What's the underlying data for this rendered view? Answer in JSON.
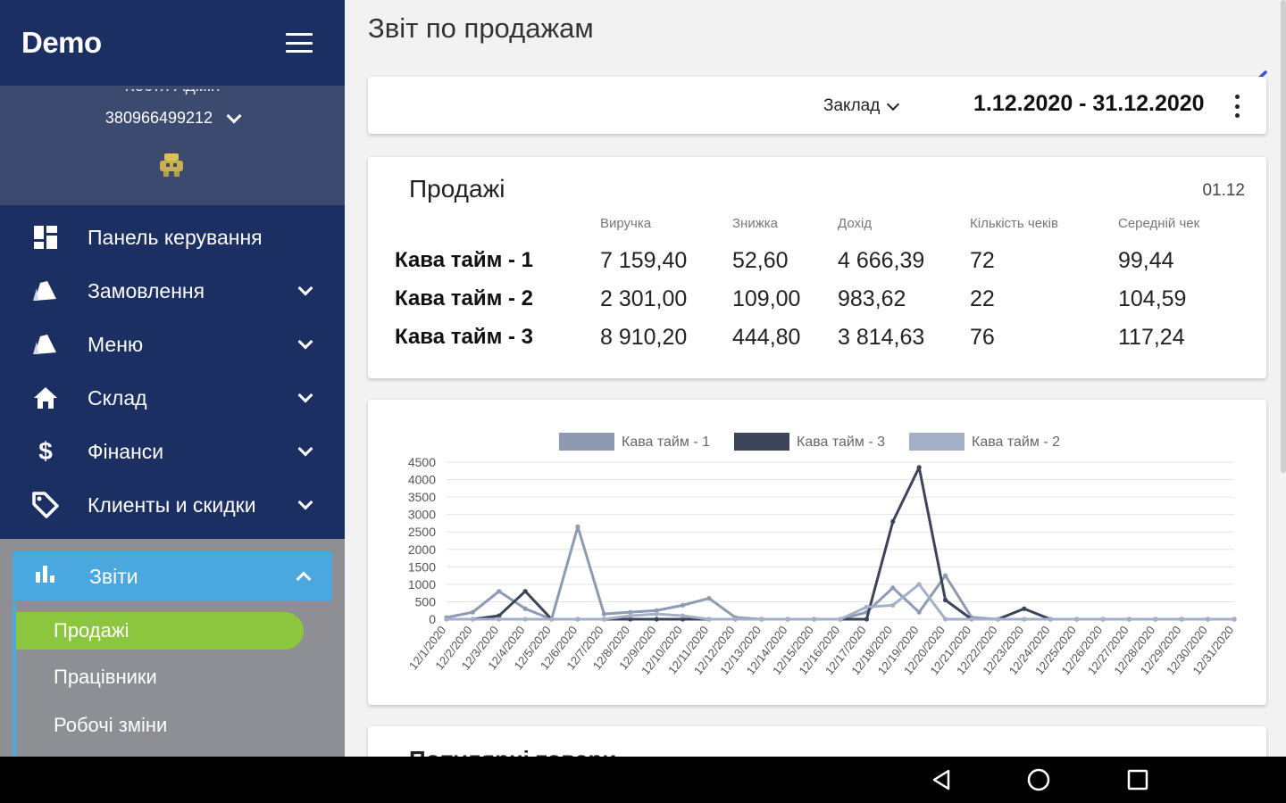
{
  "app": {
    "brand": "Demo"
  },
  "profile": {
    "name": "Костя Адмін",
    "phone": "380966499212"
  },
  "sidebar": {
    "items": [
      {
        "label": "Панель керування",
        "icon": "dashboard-icon",
        "expandable": false
      },
      {
        "label": "Замовлення",
        "icon": "orders-icon",
        "expandable": true
      },
      {
        "label": "Меню",
        "icon": "menu-book-icon",
        "expandable": true
      },
      {
        "label": "Склад",
        "icon": "home-icon",
        "expandable": true
      },
      {
        "label": "Фінанси",
        "icon": "dollar-icon",
        "expandable": true
      },
      {
        "label": "Клиенты и скидки",
        "icon": "tag-icon",
        "expandable": true
      }
    ],
    "reports": {
      "label": "Звіти",
      "icon": "bar-chart-icon",
      "subitems": [
        {
          "label": "Продажі",
          "active": true
        },
        {
          "label": "Працівники",
          "active": false
        },
        {
          "label": "Робочі зміни",
          "active": false
        }
      ]
    }
  },
  "page": {
    "title": "Звіт по продажам",
    "filter": {
      "venue_label": "Заклад",
      "date_range": "1.12.2020 - 31.12.2020"
    }
  },
  "sales": {
    "title": "Продажі",
    "date": "01.12",
    "columns": [
      "Виручка",
      "Знижка",
      "Дохід",
      "Кількість чеків",
      "Середній чек"
    ],
    "rows": [
      {
        "name": "Кава тайм - 1",
        "values": [
          "7 159,40",
          "52,60",
          "4 666,39",
          "72",
          "99,44"
        ]
      },
      {
        "name": "Кава тайм - 2",
        "values": [
          "2 301,00",
          "109,00",
          "983,62",
          "22",
          "104,59"
        ]
      },
      {
        "name": "Кава тайм - 3",
        "values": [
          "8 910,20",
          "444,80",
          "3 814,63",
          "76",
          "117,24"
        ]
      }
    ]
  },
  "chart_data": {
    "type": "line",
    "title": "",
    "xlabel": "",
    "ylabel": "",
    "ylim": [
      0,
      4500
    ],
    "yticks": [
      0,
      500,
      1000,
      1500,
      2000,
      2500,
      3000,
      3500,
      4000,
      4500
    ],
    "grid": true,
    "legend_position": "top-center",
    "categories": [
      "12/1/2020",
      "12/2/2020",
      "12/3/2020",
      "12/4/2020",
      "12/5/2020",
      "12/6/2020",
      "12/7/2020",
      "12/8/2020",
      "12/9/2020",
      "12/10/2020",
      "12/11/2020",
      "12/12/2020",
      "12/13/2020",
      "12/14/2020",
      "12/15/2020",
      "12/16/2020",
      "12/17/2020",
      "12/18/2020",
      "12/19/2020",
      "12/20/2020",
      "12/21/2020",
      "12/22/2020",
      "12/23/2020",
      "12/24/2020",
      "12/25/2020",
      "12/26/2020",
      "12/27/2020",
      "12/28/2020",
      "12/29/2020",
      "12/30/2020",
      "12/31/2020"
    ],
    "series": [
      {
        "name": "Кава тайм - 1",
        "color": "#8e9ab2",
        "values": [
          50,
          200,
          800,
          300,
          0,
          2650,
          150,
          200,
          250,
          400,
          600,
          50,
          0,
          0,
          0,
          0,
          200,
          900,
          200,
          1250,
          50,
          0,
          0,
          0,
          0,
          0,
          0,
          0,
          0,
          0,
          0
        ]
      },
      {
        "name": "Кава тайм - 3",
        "color": "#3b4458",
        "values": [
          0,
          0,
          100,
          800,
          0,
          0,
          0,
          0,
          0,
          0,
          0,
          0,
          0,
          0,
          0,
          0,
          0,
          2800,
          4350,
          550,
          0,
          0,
          300,
          0,
          0,
          0,
          0,
          0,
          0,
          0,
          0
        ]
      },
      {
        "name": "Кава тайм - 2",
        "color": "#a4afc8",
        "values": [
          0,
          0,
          0,
          0,
          0,
          0,
          0,
          100,
          150,
          100,
          0,
          0,
          0,
          0,
          0,
          0,
          350,
          400,
          1000,
          0,
          0,
          0,
          0,
          0,
          0,
          0,
          0,
          0,
          0,
          0,
          0
        ]
      }
    ]
  },
  "bottom": {
    "title": "Популярні товари"
  },
  "colors": {
    "sidebar": "#1b2f63",
    "profile_bg": "#3d4a70",
    "accent_blue": "#4aa8de",
    "accent_green": "#8cc63f",
    "submenu_bg": "#8d8f95"
  }
}
